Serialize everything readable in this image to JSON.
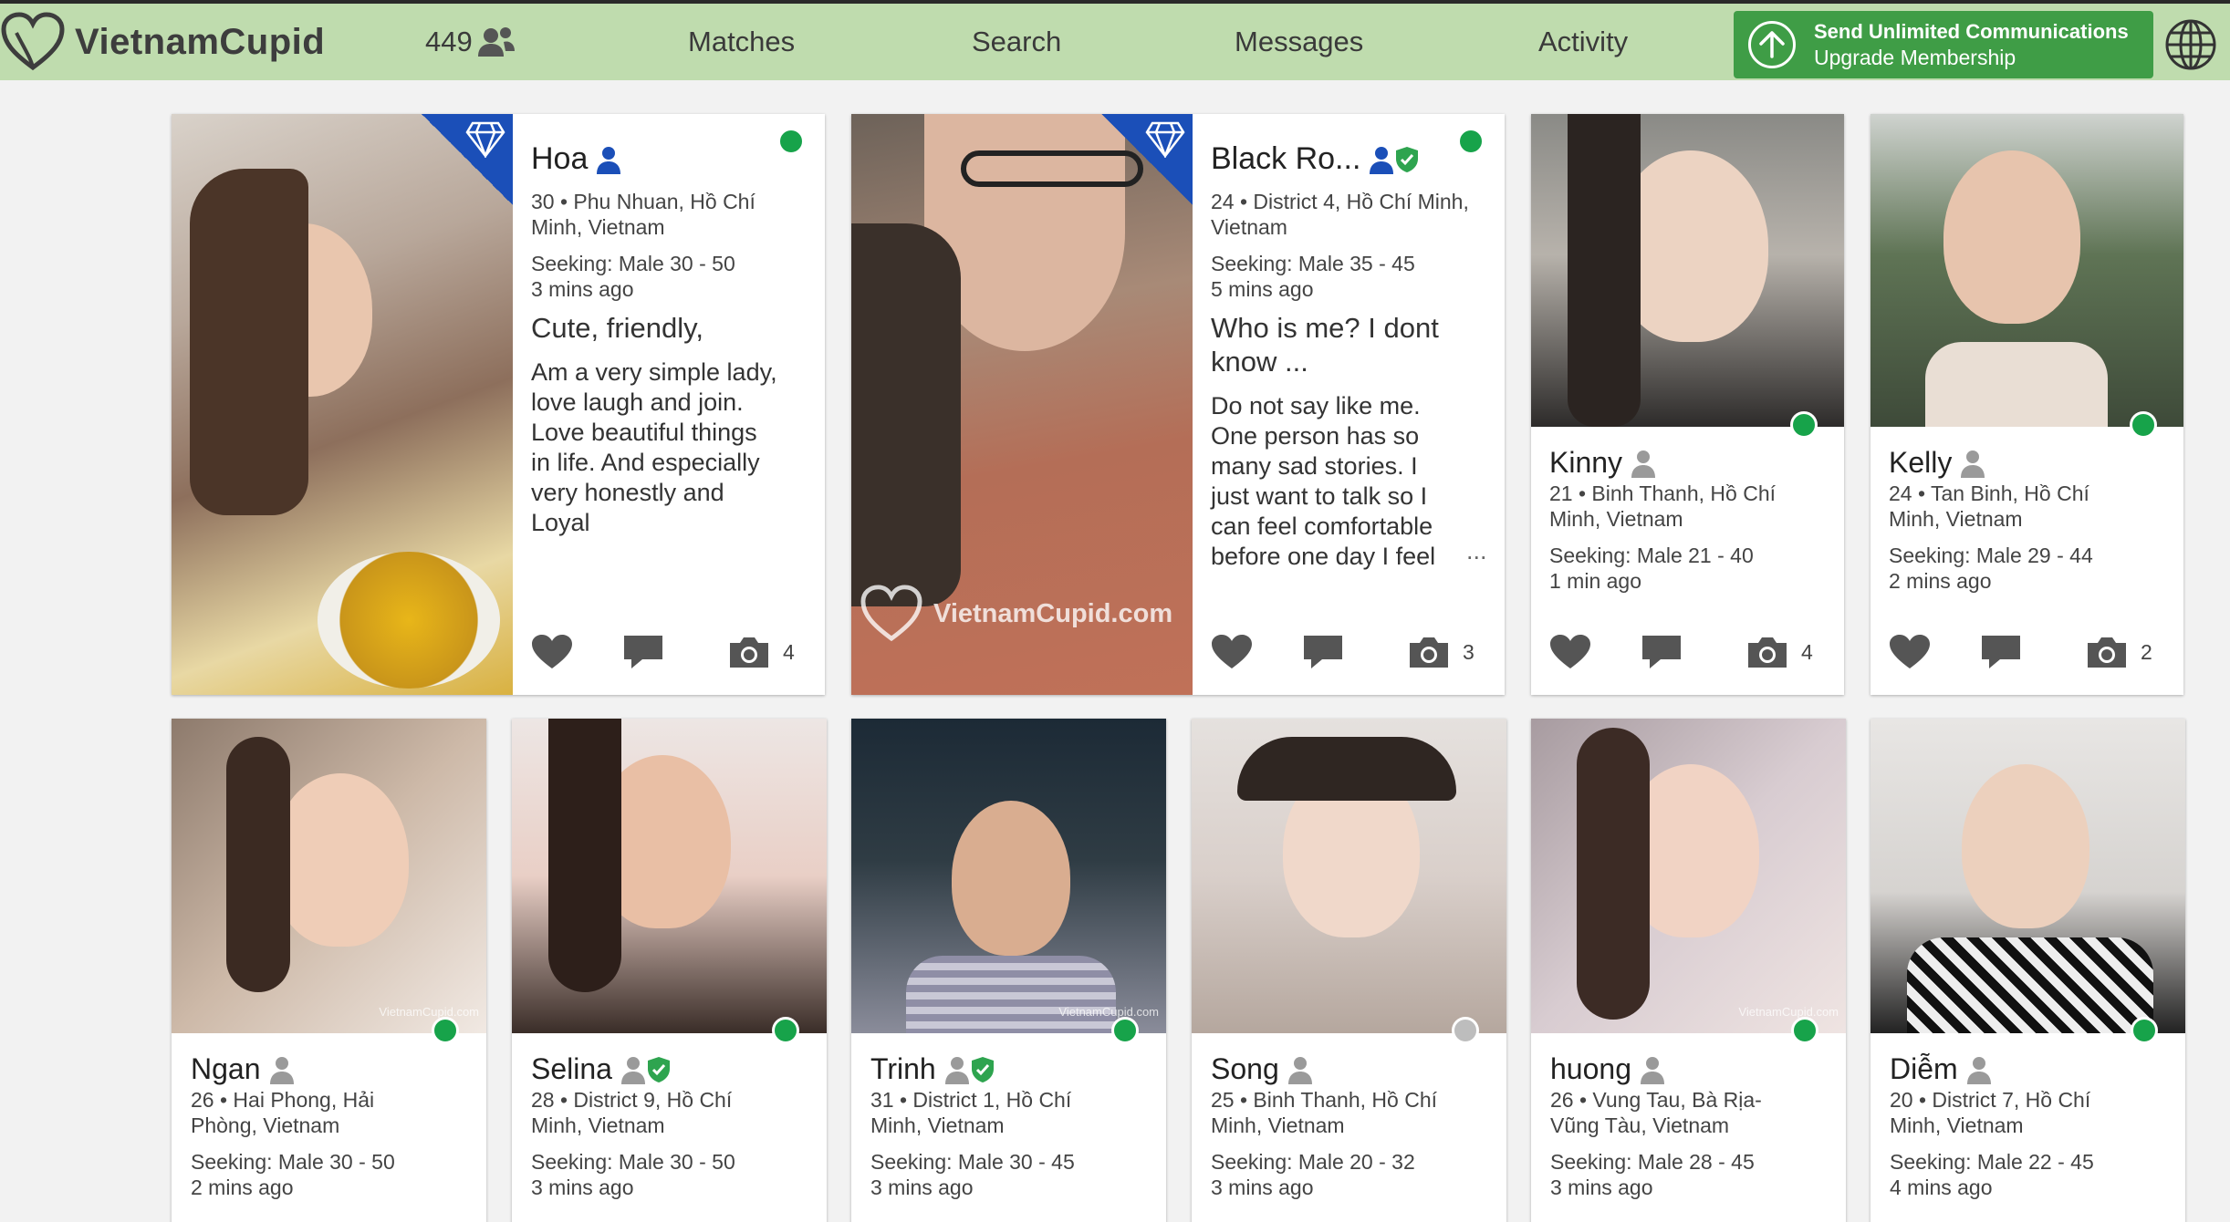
{
  "header": {
    "brand": "VietnamCupid",
    "interest_count": "449",
    "nav": [
      "Matches",
      "Search",
      "Messages",
      "Activity"
    ],
    "upgrade_line1": "Send Unlimited Communications",
    "upgrade_line2": "Upgrade Membership"
  },
  "watermark": "VietnamCupid.com",
  "colors": {
    "header_bg": "#bfdcae",
    "upgrade_bg": "#3f9d46",
    "online": "#17a34a",
    "offline": "#bdbdbd",
    "premium_banner": "#1b4fb8"
  },
  "featured": [
    {
      "name": "Hoa",
      "age_location_1": "30 • Phu Nhuan, Hồ Chí",
      "age_location_2": "Minh, Vietnam",
      "seeking": "Seeking: Male 30 - 50",
      "last_active": "3 mins ago",
      "headline": "Cute, friendly,",
      "description": [
        "Am a very simple lady,",
        "love laugh and join.",
        "Love beautiful things",
        "in life. And especially",
        "very honestly and",
        "Loyal"
      ],
      "photo_count": "4",
      "verified": false,
      "online": true
    },
    {
      "name": "Black Ro...",
      "age_location_1": "24 • District 4, Hồ Chí Minh,",
      "age_location_2": "Vietnam",
      "seeking": "Seeking: Male 35 - 45",
      "last_active": "5 mins ago",
      "headline": [
        "Who is me? I dont",
        "know ..."
      ],
      "description": [
        "Do not say like me.",
        "One person has so",
        "many sad stories. I",
        "just want to talk so I",
        "can feel comfortable",
        "before one day I feel"
      ],
      "ellipsis": "...",
      "photo_count": "3",
      "verified": true,
      "online": true
    }
  ],
  "small_top": [
    {
      "name": "Kinny",
      "age_location_1": "21 • Binh Thanh, Hồ Chí",
      "age_location_2": "Minh, Vietnam",
      "seeking": "Seeking: Male 21 - 40",
      "last_active": "1 min ago",
      "photo_count": "4",
      "online": true
    },
    {
      "name": "Kelly",
      "age_location_1": "24 • Tan Binh, Hồ Chí",
      "age_location_2": "Minh, Vietnam",
      "seeking": "Seeking: Male 29 - 44",
      "last_active": "2 mins ago",
      "photo_count": "2",
      "online": true
    }
  ],
  "bottom": [
    {
      "name": "Ngan",
      "age_location_1": "26 • Hai Phong, Hải",
      "age_location_2": "Phòng, Vietnam",
      "seeking": "Seeking: Male 30 - 50",
      "last_active": "2 mins ago",
      "verified": false,
      "online": true
    },
    {
      "name": "Selina",
      "age_location_1": "28 • District 9, Hồ Chí",
      "age_location_2": "Minh, Vietnam",
      "seeking": "Seeking: Male 30 - 50",
      "last_active": "3 mins ago",
      "verified": true,
      "online": true
    },
    {
      "name": "Trinh",
      "age_location_1": "31 • District 1, Hồ Chí",
      "age_location_2": "Minh, Vietnam",
      "seeking": "Seeking: Male 30 - 45",
      "last_active": "3 mins ago",
      "verified": true,
      "online": true
    },
    {
      "name": "Song",
      "age_location_1": "25 • Binh Thanh, Hồ Chí",
      "age_location_2": "Minh, Vietnam",
      "seeking": "Seeking: Male 20 - 32",
      "last_active": "3 mins ago",
      "verified": false,
      "online": false
    },
    {
      "name": "huong",
      "age_location_1": "26 • Vung Tau, Bà Rịa-",
      "age_location_2": "Vũng Tàu, Vietnam",
      "seeking": "Seeking: Male 28 - 45",
      "last_active": "3 mins ago",
      "verified": false,
      "online": true
    },
    {
      "name": "Diễm",
      "age_location_1": "20 • District 7, Hồ Chí",
      "age_location_2": "Minh, Vietnam",
      "seeking": "Seeking: Male 22 - 45",
      "last_active": "4 mins ago",
      "verified": false,
      "online": true
    }
  ]
}
